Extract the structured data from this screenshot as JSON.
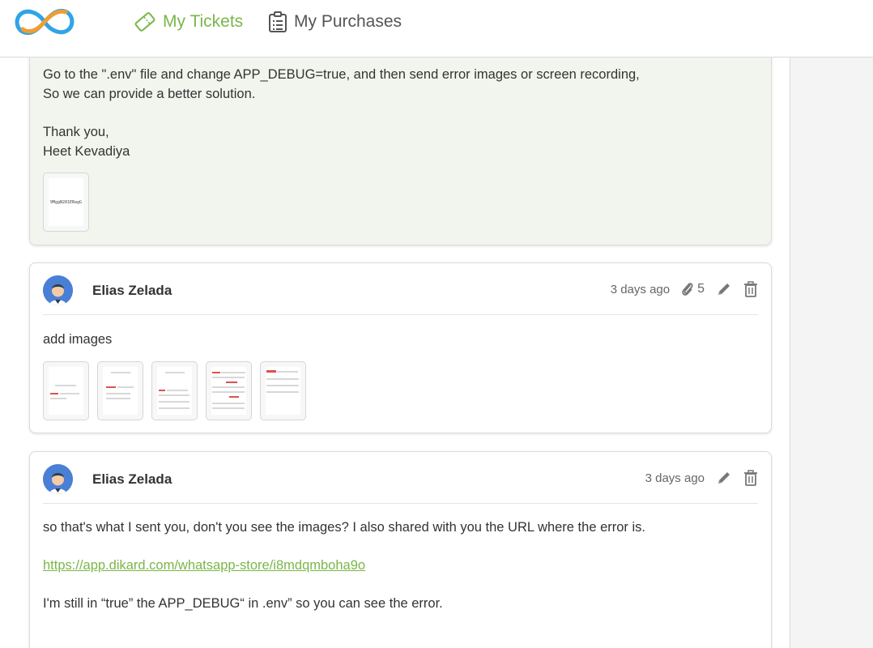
{
  "header": {
    "nav": [
      {
        "label": "My Tickets",
        "icon": "ticket-icon",
        "color": "#7ab648"
      },
      {
        "label": "My Purchases",
        "icon": "clipboard-icon",
        "color": "#555555"
      }
    ]
  },
  "reply": {
    "line1": "Go to the \".env\" file and change APP_DEBUG=true, and then send error images or screen recording,",
    "line2": "So we can provide a better solution.",
    "line3": "Thank you,",
    "line4": "Heet Kevadiya",
    "attachment_label": "9MggN281EBagG"
  },
  "comments": [
    {
      "author": "Elias Zelada",
      "time": "3 days ago",
      "attachment_count": "5",
      "body": "add images"
    },
    {
      "author": "Elias Zelada",
      "time": "3 days ago",
      "line1": "so that's what I sent you, don't you see the images? I also shared with you the URL where the error is.",
      "link": "https://app.dikard.com/whatsapp-store/i8mdqmboha9o",
      "line3": "I'm still in “true” the APP_DEBUG“ in .env” so you can see the error."
    }
  ],
  "colors": {
    "accent": "#7ab648",
    "agent_bg": "#f2f5ee",
    "logo_blue": "#2fa4e7",
    "logo_orange": "#f39c32"
  }
}
